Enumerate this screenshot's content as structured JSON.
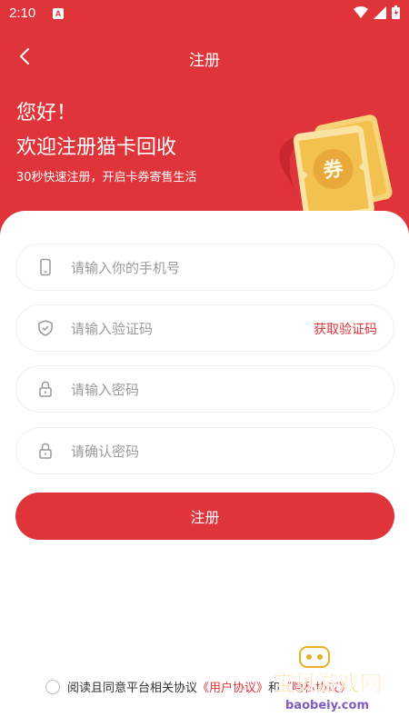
{
  "status_bar": {
    "time": "2:10"
  },
  "nav": {
    "title": "注册"
  },
  "hero": {
    "greeting": "您好！",
    "welcome": "欢迎注册猫卡回收",
    "subtitle": "30秒快速注册，开启卡券寄售生活",
    "ticket_text": "券"
  },
  "form": {
    "phone_placeholder": "请输入你的手机号",
    "code_placeholder": "请输入验证码",
    "get_code_label": "获取验证码",
    "password_placeholder": "请输入密码",
    "confirm_placeholder": "请确认密码",
    "submit_label": "注册"
  },
  "agreement": {
    "prefix": "阅读且同意平台相关协议",
    "user_agreement": "《用户协议》",
    "conjunction": "和",
    "privacy_policy": "《隐私协议》"
  },
  "watermark": {
    "title": "宝贝游戏网",
    "url": "baobeiy.com"
  },
  "colors": {
    "brand": "#e0343b",
    "ticket_gold": "#f2c14e"
  }
}
